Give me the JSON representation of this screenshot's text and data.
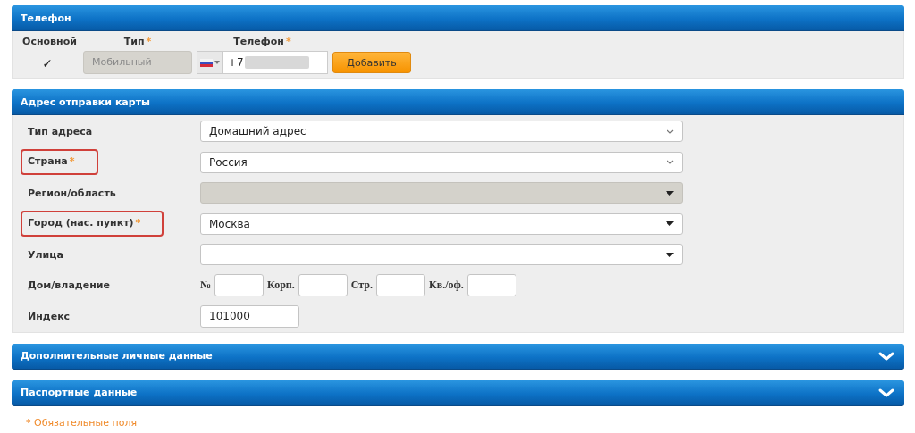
{
  "required_mark": "*",
  "phone": {
    "title": "Телефон",
    "columns": [
      {
        "label": "Основной",
        "required": false
      },
      {
        "label": "Тип",
        "required": true
      },
      {
        "label": "Телефон",
        "required": true
      }
    ],
    "primary_checked": true,
    "check_mark": "✓",
    "type_value": "Мобильный",
    "type_disabled": true,
    "phone_value": "+7",
    "add_button": "Добавить"
  },
  "address": {
    "title": "Адрес отправки карты",
    "rows": [
      {
        "label": "Тип адреса",
        "required": false,
        "highlighted": false,
        "kind": "select",
        "value": "Домашний адрес",
        "disabled": false
      },
      {
        "label": "Страна",
        "required": true,
        "highlighted": true,
        "kind": "select",
        "value": "Россия",
        "disabled": false
      },
      {
        "label": "Регион/область",
        "required": false,
        "highlighted": false,
        "kind": "combo",
        "disabled": true
      },
      {
        "label": "Город (нас. пункт)",
        "required": true,
        "highlighted": true,
        "kind": "combo",
        "value": "Москва",
        "disabled": false
      },
      {
        "label": "Улица",
        "required": false,
        "highlighted": false,
        "kind": "combo",
        "disabled": false
      },
      {
        "label": "Дом/владение",
        "required": false,
        "highlighted": false,
        "kind": "parts",
        "parts": [
          "№",
          "Корп.",
          "Стр.",
          "Кв./оф."
        ]
      },
      {
        "label": "Индекс",
        "required": false,
        "highlighted": false,
        "kind": "text",
        "value": "101000"
      }
    ]
  },
  "collapsed_sections": [
    {
      "title": "Дополнительные личные данные",
      "expanded": false
    },
    {
      "title": "Паспортные данные",
      "expanded": false
    }
  ],
  "footnote": "* Обязательные поля"
}
